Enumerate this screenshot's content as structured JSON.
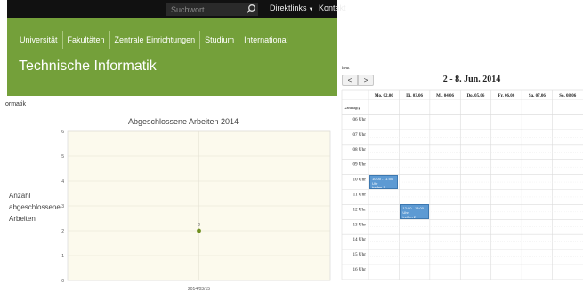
{
  "site": {
    "search": {
      "placeholder": "Suchwort",
      "value": ""
    },
    "direktlinks_label": "Direktlinks",
    "kontakt_label": "Kontakt",
    "nav": [
      "Universität",
      "Fakultäten",
      "Zentrale Einrichtungen",
      "Studium",
      "International"
    ],
    "page_title": "Technische Informatik",
    "breadcrumb": "ormatik",
    "header_color": "#74a03a"
  },
  "chart_data": {
    "type": "scatter",
    "title": "Abgeschlossene Arbeiten 2014",
    "ylabel": "Anzahl abgeschlossene Arbeiten",
    "xlabel": "",
    "ylim": [
      0,
      6
    ],
    "yticks": [
      0,
      1,
      2,
      3,
      4,
      5,
      6
    ],
    "categories": [
      "2014/03/15"
    ],
    "values": [
      2
    ],
    "data_labels": [
      "2"
    ],
    "grid": true,
    "legend": "none",
    "point_color": "#6f8f1f",
    "background": "#fcfaed"
  },
  "calendar": {
    "today_label": "heut",
    "prev_label": "<",
    "next_label": ">",
    "title": "2 - 8. Jun. 2014",
    "allday_label": "Ganztägig",
    "days": [
      "Mo. 02.06",
      "Di. 03.06",
      "Mi. 04.06",
      "Do. 05.06",
      "Fr. 06.06",
      "Sa. 07.06",
      "So. 08.06"
    ],
    "hours": [
      "06 Uhr",
      "07 Uhr",
      "08 Uhr",
      "09 Uhr",
      "10 Uhr",
      "11 Uhr",
      "12 Uhr",
      "13 Uhr",
      "14 Uhr",
      "15 Uhr",
      "16 Uhr"
    ],
    "events": [
      {
        "day": 0,
        "start": 10,
        "end": 11,
        "time": "10:00 - 11:00 Uhr",
        "title": "treffen 1"
      },
      {
        "day": 1,
        "start": 12,
        "end": 13,
        "time": "12:00 - 13:00 Uhr",
        "title": "treffen 2"
      }
    ],
    "event_color": "#5d9ad3"
  }
}
